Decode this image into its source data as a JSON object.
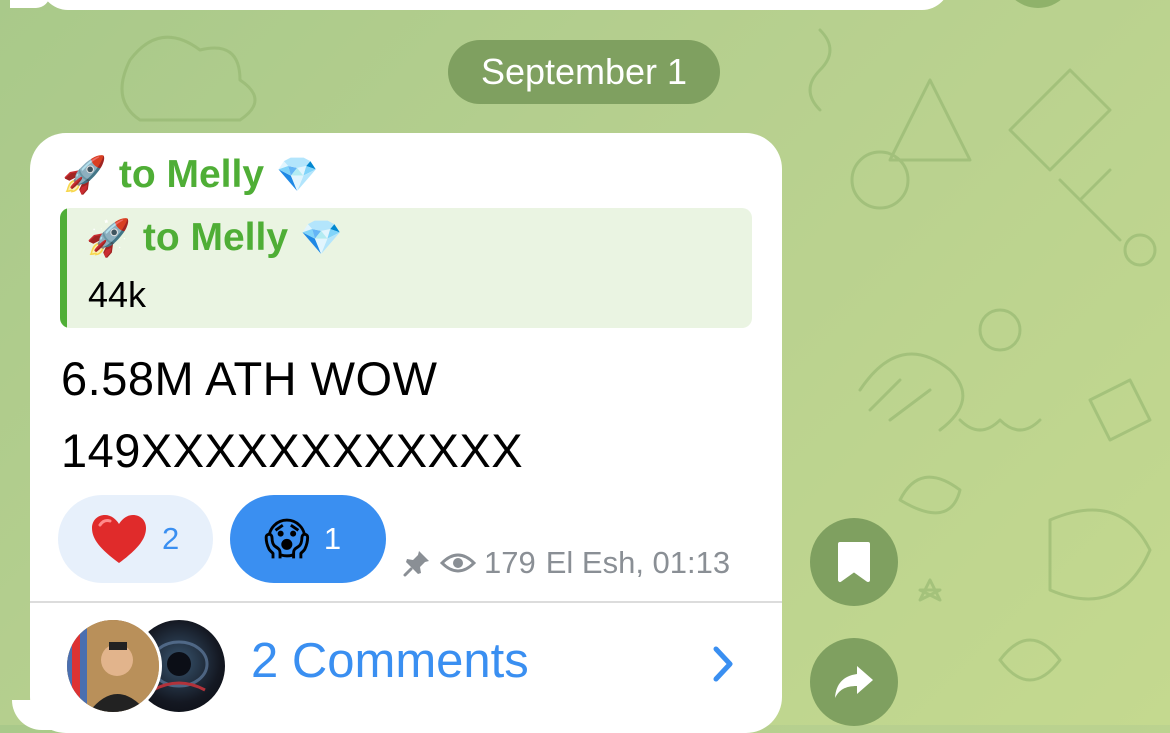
{
  "date_separator": "September 1",
  "message": {
    "author": {
      "emoji": "🚀",
      "name": "to Melly",
      "badge": "💎"
    },
    "reply": {
      "author": {
        "emoji": "🚀",
        "name": "to Melly",
        "badge": "💎"
      },
      "text": "44k"
    },
    "lines": [
      "6.58M ATH WOW",
      "149XXXXXXXXXXXX"
    ],
    "reactions": [
      {
        "emoji": "❤️",
        "count": "2",
        "selected": false
      },
      {
        "emoji": "😱",
        "count": "1",
        "selected": true
      }
    ],
    "meta": {
      "pinned_icon": "pin-icon",
      "views_icon": "eye-icon",
      "views": "179",
      "signature": "El Esh, 01:13"
    },
    "comments": {
      "label": "2 Comments"
    }
  },
  "side_actions": [
    {
      "icon": "bookmark-icon"
    },
    {
      "icon": "share-icon"
    }
  ],
  "colors": {
    "accent": "#3a8ff1",
    "author": "#4fae36",
    "wallpaper": "#b7d08f",
    "pill": "#7fa060"
  }
}
